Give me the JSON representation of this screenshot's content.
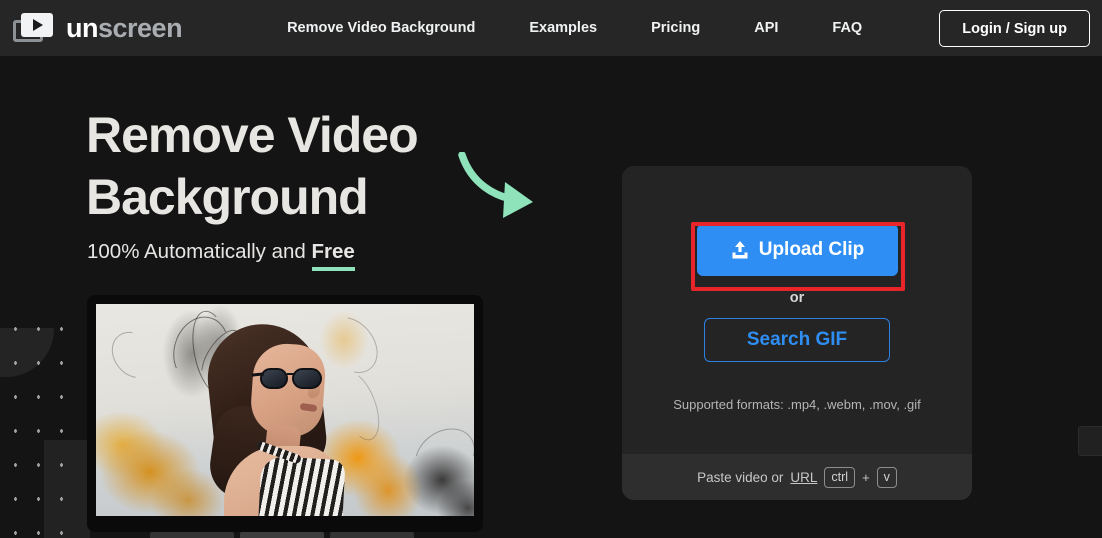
{
  "nav": {
    "brand": {
      "part1": "un",
      "part2": "screen",
      "logo_icon": "video-frames-play-icon"
    },
    "links": [
      {
        "label": "Remove Video Background"
      },
      {
        "label": "Examples"
      },
      {
        "label": "Pricing"
      },
      {
        "label": "API"
      },
      {
        "label": "FAQ"
      }
    ],
    "login_label": "Login / Sign up"
  },
  "hero": {
    "heading_line1": "Remove Video",
    "heading_line2": "Background",
    "sub_prefix": "100% Automatically and ",
    "sub_emphasis": "Free",
    "arrow_icon": "curved-arrow-right-icon",
    "arrow_color": "#8fe3ba"
  },
  "preview": {
    "alt": "video-preview-woman-sunglasses-ink-background"
  },
  "card": {
    "upload_label": "Upload Clip",
    "upload_icon": "upload-icon",
    "upload_color": "#2f8ef4",
    "or_label": "or",
    "search_gif_label": "Search GIF",
    "formats_label": "Supported formats: .mp4, .webm, .mov, .gif",
    "footer": {
      "paste_prefix": "Paste video or ",
      "url_label": "URL",
      "key1": "ctrl",
      "plus": "+",
      "key2": "v"
    }
  },
  "annotation": {
    "highlight_color": "#e8252a",
    "target": "upload-clip-button"
  }
}
